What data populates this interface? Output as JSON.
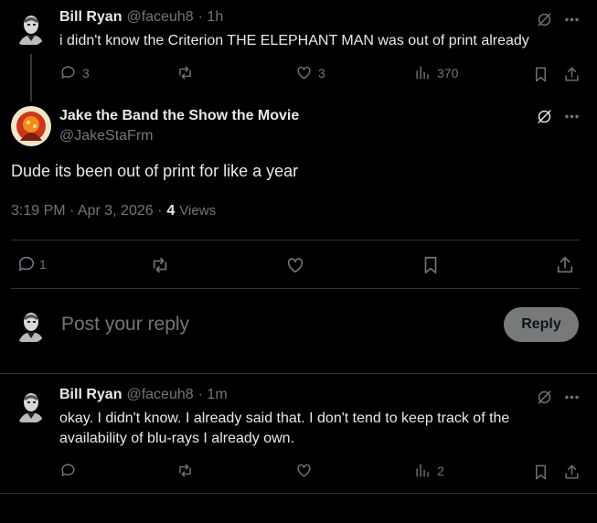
{
  "tweet1": {
    "name": "Bill Ryan",
    "handle": "@faceuh8",
    "time": "· 1h",
    "text": "i didn't know the Criterion THE ELEPHANT MAN was out of print already",
    "replies": "3",
    "likes": "3",
    "views": "370"
  },
  "main": {
    "name": "Jake the Band the Show the Movie",
    "handle": "@JakeStaFrm",
    "text": "Dude its been out of print for like a year",
    "timestamp": "3:19 PM · Apr 3, 2026 ·",
    "views_count": "4",
    "views_label": "Views",
    "replies": "1"
  },
  "compose": {
    "placeholder": "Post your reply",
    "button": "Reply"
  },
  "tweet2": {
    "name": "Bill Ryan",
    "handle": "@faceuh8",
    "time": "· 1m",
    "text_line1": "okay. I didn't know. I already said that. I don't tend to keep track of the",
    "text_line2": "availability of blu-rays I already own.",
    "views": "2"
  },
  "colors": {
    "background": "#000000",
    "text": "#e7e9ea",
    "muted": "#71767b",
    "divider": "#2f3336",
    "reply_button": "#787a7a"
  }
}
